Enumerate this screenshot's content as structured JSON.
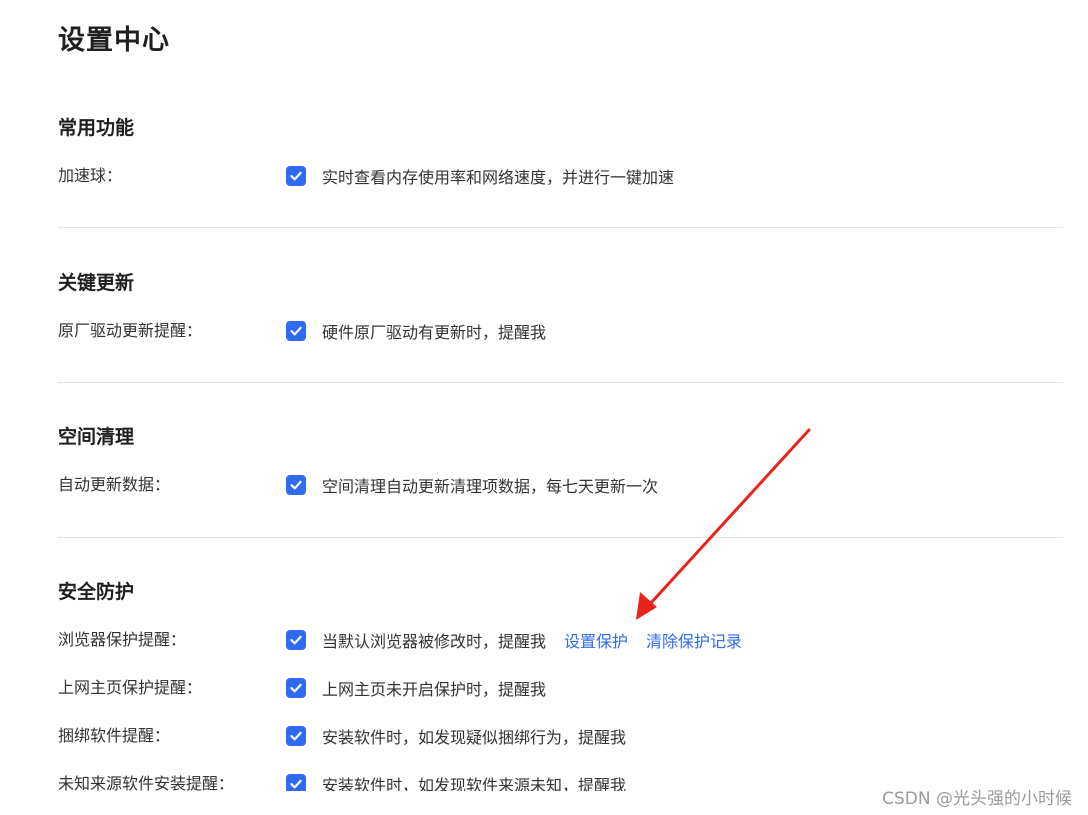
{
  "page": {
    "title": "设置中心"
  },
  "sections": [
    {
      "title": "常用功能",
      "rows": [
        {
          "label": "加速球：",
          "checked": true,
          "desc": "实时查看内存使用率和网络速度，并进行一键加速"
        }
      ]
    },
    {
      "title": "关键更新",
      "rows": [
        {
          "label": "原厂驱动更新提醒：",
          "checked": true,
          "desc": "硬件原厂驱动有更新时，提醒我"
        }
      ]
    },
    {
      "title": "空间清理",
      "rows": [
        {
          "label": "自动更新数据：",
          "checked": true,
          "desc": "空间清理自动更新清理项数据，每七天更新一次"
        }
      ]
    },
    {
      "title": "安全防护",
      "rows": [
        {
          "label": "浏览器保护提醒：",
          "checked": true,
          "desc": "当默认浏览器被修改时，提醒我",
          "links": [
            "设置保护",
            "清除保护记录"
          ]
        },
        {
          "label": "上网主页保护提醒：",
          "checked": true,
          "desc": "上网主页未开启保护时，提醒我"
        },
        {
          "label": "捆绑软件提醒：",
          "checked": true,
          "desc": "安装软件时，如发现疑似捆绑行为，提醒我"
        },
        {
          "label": "未知来源软件安装提醒：",
          "checked": true,
          "desc": "安装软件时，如发现软件来源未知，提醒我"
        }
      ]
    }
  ],
  "watermark": "CSDN @光头强的小时候",
  "colors": {
    "accent": "#2f6bf0",
    "annotation_arrow": "#e8231c",
    "divider": "#e6e6e6"
  },
  "icons": {
    "checkbox": "checkmark-icon",
    "annotation": "red-arrow-icon"
  }
}
